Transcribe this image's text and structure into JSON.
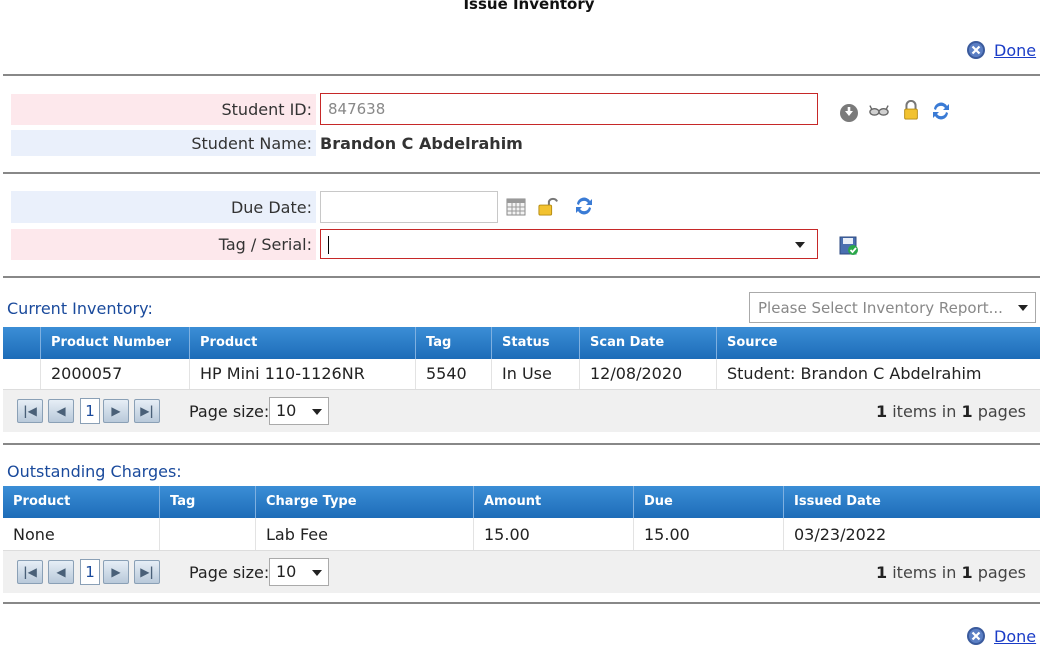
{
  "window": {
    "title": "Issue Inventory"
  },
  "done_label": "Done",
  "student": {
    "id_label": "Student ID:",
    "id_value": "847638",
    "name_label": "Student Name:",
    "name_value": "Brandon C Abdelrahim"
  },
  "issue": {
    "due_label": "Due Date:",
    "due_value": "",
    "tag_label": "Tag / Serial:",
    "tag_value": ""
  },
  "current_inventory": {
    "title": "Current Inventory:",
    "report_placeholder": "Please Select Inventory Report...",
    "columns": [
      "Product Number",
      "Product",
      "Tag",
      "Status",
      "Scan Date",
      "Source"
    ],
    "rows": [
      [
        "2000057",
        "HP Mini 110-1126NR",
        "5540",
        "In Use",
        "12/08/2020",
        "Student: Brandon C Abdelrahim"
      ]
    ],
    "pager": {
      "page": "1",
      "size_label": "Page size:",
      "size": "10",
      "items": "1",
      "items_in": "items in",
      "pages": "1",
      "pages_label": "pages"
    }
  },
  "charges": {
    "title": "Outstanding Charges:",
    "columns": [
      "Product",
      "Tag",
      "Charge Type",
      "Amount",
      "Due",
      "Issued Date"
    ],
    "rows": [
      [
        "None",
        "",
        "Lab Fee",
        "15.00",
        "15.00",
        "03/23/2022"
      ]
    ],
    "pager": {
      "page": "1",
      "size_label": "Page size:",
      "size": "10",
      "items": "1",
      "items_in": "items in",
      "pages": "1",
      "pages_label": "pages"
    }
  },
  "icons": [
    "close-circle-icon",
    "down-arrow-icon",
    "glasses-icon",
    "lock-icon",
    "refresh-icon",
    "calendar-icon",
    "unlock-icon",
    "save-icon",
    "first-page-icon",
    "prev-page-icon",
    "next-page-icon",
    "last-page-icon"
  ],
  "colors": {
    "accent": "#1d6cb8",
    "required_border": "#c62828",
    "link": "#1a3cc7"
  }
}
